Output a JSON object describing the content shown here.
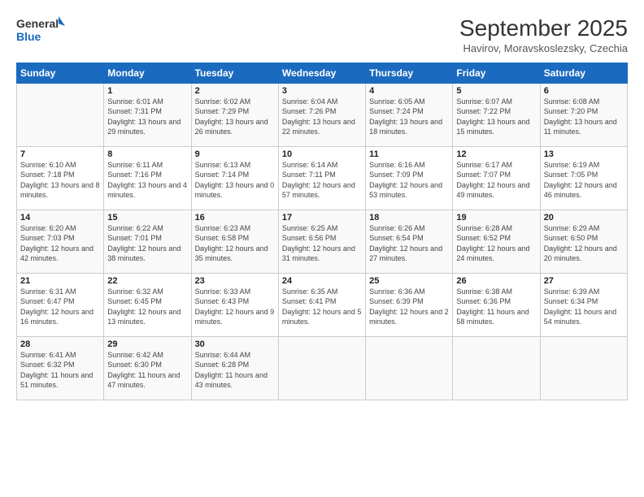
{
  "header": {
    "logo_line1": "General",
    "logo_line2": "Blue",
    "month": "September 2025",
    "location": "Havirov, Moravskoslezsky, Czechia"
  },
  "days_of_week": [
    "Sunday",
    "Monday",
    "Tuesday",
    "Wednesday",
    "Thursday",
    "Friday",
    "Saturday"
  ],
  "weeks": [
    [
      {
        "day": "",
        "sunrise": "",
        "sunset": "",
        "daylight": ""
      },
      {
        "day": "1",
        "sunrise": "Sunrise: 6:01 AM",
        "sunset": "Sunset: 7:31 PM",
        "daylight": "Daylight: 13 hours and 29 minutes."
      },
      {
        "day": "2",
        "sunrise": "Sunrise: 6:02 AM",
        "sunset": "Sunset: 7:29 PM",
        "daylight": "Daylight: 13 hours and 26 minutes."
      },
      {
        "day": "3",
        "sunrise": "Sunrise: 6:04 AM",
        "sunset": "Sunset: 7:26 PM",
        "daylight": "Daylight: 13 hours and 22 minutes."
      },
      {
        "day": "4",
        "sunrise": "Sunrise: 6:05 AM",
        "sunset": "Sunset: 7:24 PM",
        "daylight": "Daylight: 13 hours and 18 minutes."
      },
      {
        "day": "5",
        "sunrise": "Sunrise: 6:07 AM",
        "sunset": "Sunset: 7:22 PM",
        "daylight": "Daylight: 13 hours and 15 minutes."
      },
      {
        "day": "6",
        "sunrise": "Sunrise: 6:08 AM",
        "sunset": "Sunset: 7:20 PM",
        "daylight": "Daylight: 13 hours and 11 minutes."
      }
    ],
    [
      {
        "day": "7",
        "sunrise": "Sunrise: 6:10 AM",
        "sunset": "Sunset: 7:18 PM",
        "daylight": "Daylight: 13 hours and 8 minutes."
      },
      {
        "day": "8",
        "sunrise": "Sunrise: 6:11 AM",
        "sunset": "Sunset: 7:16 PM",
        "daylight": "Daylight: 13 hours and 4 minutes."
      },
      {
        "day": "9",
        "sunrise": "Sunrise: 6:13 AM",
        "sunset": "Sunset: 7:14 PM",
        "daylight": "Daylight: 13 hours and 0 minutes."
      },
      {
        "day": "10",
        "sunrise": "Sunrise: 6:14 AM",
        "sunset": "Sunset: 7:11 PM",
        "daylight": "Daylight: 12 hours and 57 minutes."
      },
      {
        "day": "11",
        "sunrise": "Sunrise: 6:16 AM",
        "sunset": "Sunset: 7:09 PM",
        "daylight": "Daylight: 12 hours and 53 minutes."
      },
      {
        "day": "12",
        "sunrise": "Sunrise: 6:17 AM",
        "sunset": "Sunset: 7:07 PM",
        "daylight": "Daylight: 12 hours and 49 minutes."
      },
      {
        "day": "13",
        "sunrise": "Sunrise: 6:19 AM",
        "sunset": "Sunset: 7:05 PM",
        "daylight": "Daylight: 12 hours and 46 minutes."
      }
    ],
    [
      {
        "day": "14",
        "sunrise": "Sunrise: 6:20 AM",
        "sunset": "Sunset: 7:03 PM",
        "daylight": "Daylight: 12 hours and 42 minutes."
      },
      {
        "day": "15",
        "sunrise": "Sunrise: 6:22 AM",
        "sunset": "Sunset: 7:01 PM",
        "daylight": "Daylight: 12 hours and 38 minutes."
      },
      {
        "day": "16",
        "sunrise": "Sunrise: 6:23 AM",
        "sunset": "Sunset: 6:58 PM",
        "daylight": "Daylight: 12 hours and 35 minutes."
      },
      {
        "day": "17",
        "sunrise": "Sunrise: 6:25 AM",
        "sunset": "Sunset: 6:56 PM",
        "daylight": "Daylight: 12 hours and 31 minutes."
      },
      {
        "day": "18",
        "sunrise": "Sunrise: 6:26 AM",
        "sunset": "Sunset: 6:54 PM",
        "daylight": "Daylight: 12 hours and 27 minutes."
      },
      {
        "day": "19",
        "sunrise": "Sunrise: 6:28 AM",
        "sunset": "Sunset: 6:52 PM",
        "daylight": "Daylight: 12 hours and 24 minutes."
      },
      {
        "day": "20",
        "sunrise": "Sunrise: 6:29 AM",
        "sunset": "Sunset: 6:50 PM",
        "daylight": "Daylight: 12 hours and 20 minutes."
      }
    ],
    [
      {
        "day": "21",
        "sunrise": "Sunrise: 6:31 AM",
        "sunset": "Sunset: 6:47 PM",
        "daylight": "Daylight: 12 hours and 16 minutes."
      },
      {
        "day": "22",
        "sunrise": "Sunrise: 6:32 AM",
        "sunset": "Sunset: 6:45 PM",
        "daylight": "Daylight: 12 hours and 13 minutes."
      },
      {
        "day": "23",
        "sunrise": "Sunrise: 6:33 AM",
        "sunset": "Sunset: 6:43 PM",
        "daylight": "Daylight: 12 hours and 9 minutes."
      },
      {
        "day": "24",
        "sunrise": "Sunrise: 6:35 AM",
        "sunset": "Sunset: 6:41 PM",
        "daylight": "Daylight: 12 hours and 5 minutes."
      },
      {
        "day": "25",
        "sunrise": "Sunrise: 6:36 AM",
        "sunset": "Sunset: 6:39 PM",
        "daylight": "Daylight: 12 hours and 2 minutes."
      },
      {
        "day": "26",
        "sunrise": "Sunrise: 6:38 AM",
        "sunset": "Sunset: 6:36 PM",
        "daylight": "Daylight: 11 hours and 58 minutes."
      },
      {
        "day": "27",
        "sunrise": "Sunrise: 6:39 AM",
        "sunset": "Sunset: 6:34 PM",
        "daylight": "Daylight: 11 hours and 54 minutes."
      }
    ],
    [
      {
        "day": "28",
        "sunrise": "Sunrise: 6:41 AM",
        "sunset": "Sunset: 6:32 PM",
        "daylight": "Daylight: 11 hours and 51 minutes."
      },
      {
        "day": "29",
        "sunrise": "Sunrise: 6:42 AM",
        "sunset": "Sunset: 6:30 PM",
        "daylight": "Daylight: 11 hours and 47 minutes."
      },
      {
        "day": "30",
        "sunrise": "Sunrise: 6:44 AM",
        "sunset": "Sunset: 6:28 PM",
        "daylight": "Daylight: 11 hours and 43 minutes."
      },
      {
        "day": "",
        "sunrise": "",
        "sunset": "",
        "daylight": ""
      },
      {
        "day": "",
        "sunrise": "",
        "sunset": "",
        "daylight": ""
      },
      {
        "day": "",
        "sunrise": "",
        "sunset": "",
        "daylight": ""
      },
      {
        "day": "",
        "sunrise": "",
        "sunset": "",
        "daylight": ""
      }
    ]
  ]
}
